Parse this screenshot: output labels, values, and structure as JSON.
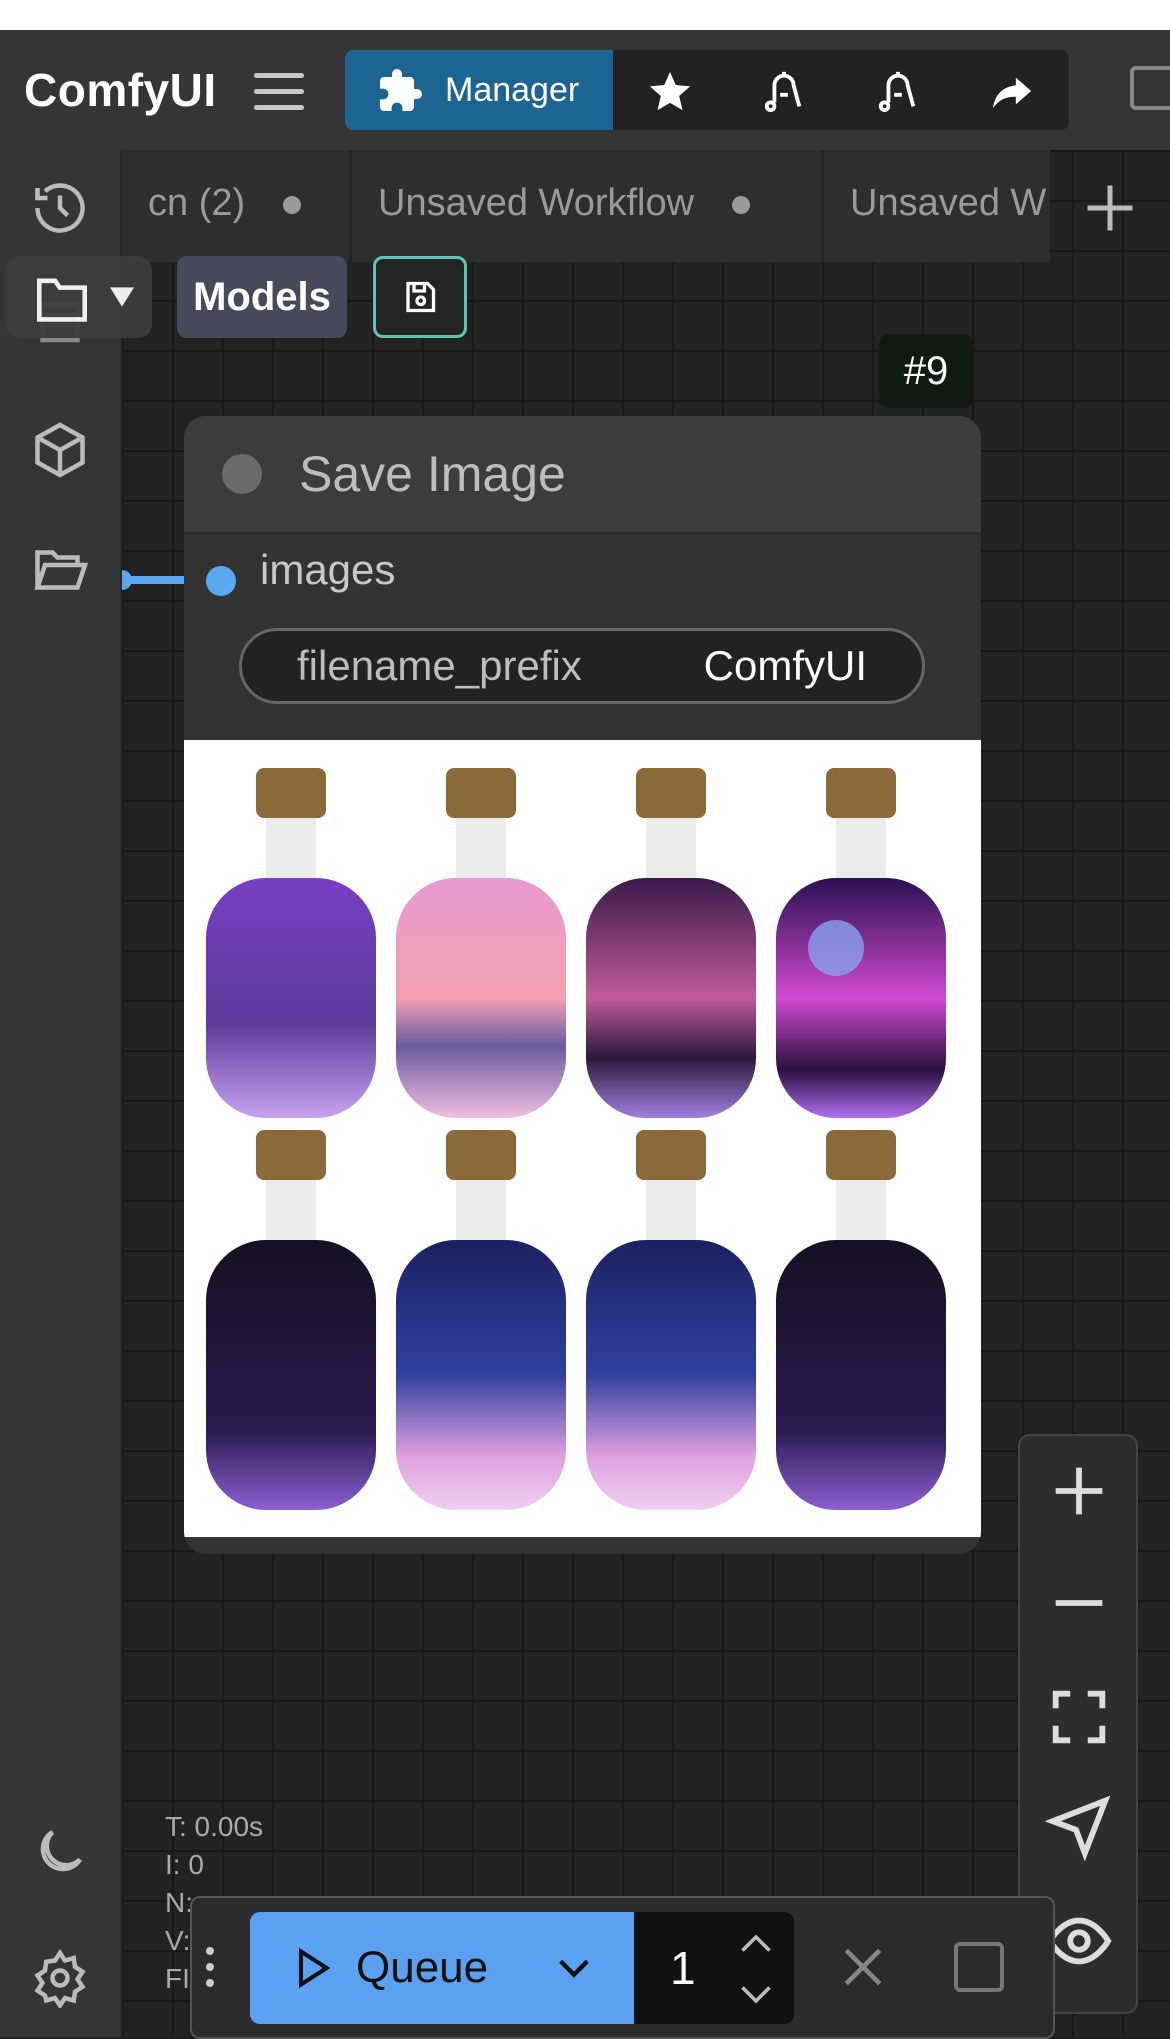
{
  "app": {
    "title": "ComfyUI"
  },
  "toolbar": {
    "manager_label": "Manager",
    "buttons": [
      "star-icon",
      "bell-sound-icon",
      "bell-sound-icon-2",
      "share-icon"
    ]
  },
  "tabs": [
    {
      "label": "cn (2)",
      "modified": true
    },
    {
      "label": "Unsaved Workflow",
      "modified": true
    },
    {
      "label": "Unsaved W",
      "modified": false
    }
  ],
  "subtoolbar": {
    "models_label": "Models"
  },
  "node": {
    "badge": "#9",
    "title": "Save Image",
    "input_label": "images",
    "widget": {
      "name": "filename_prefix",
      "value": "ComfyUI"
    }
  },
  "stats": {
    "t": "T: 0.00s",
    "i": "I: 0",
    "n": "N:",
    "v": "V:",
    "f": "FI"
  },
  "queue": {
    "label": "Queue",
    "count": "1"
  },
  "colors": {
    "accent": "#1c6593",
    "queue": "#5aa1f2",
    "link": "#5aa8f0",
    "save_border": "#5fc4b3"
  }
}
